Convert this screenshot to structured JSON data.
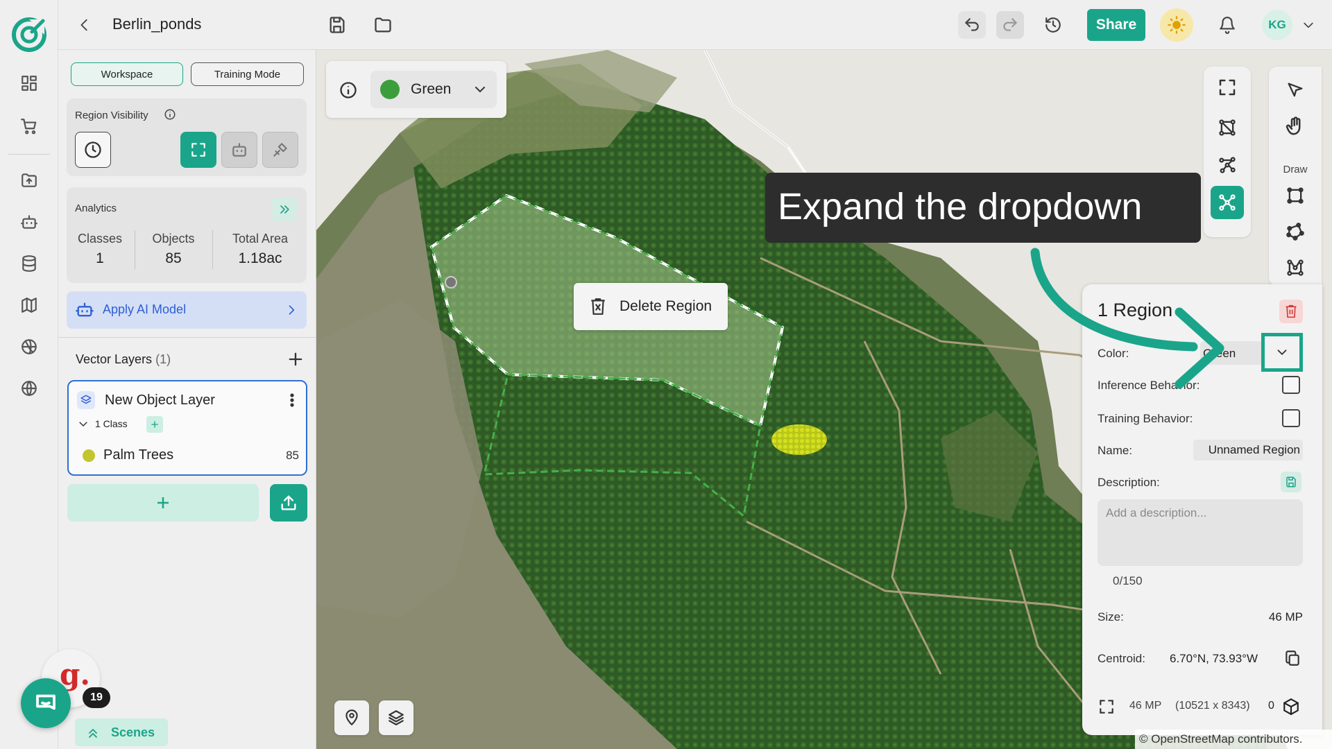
{
  "header": {
    "project_title": "Berlin_ponds",
    "share_label": "Share",
    "avatar_initials": "KG"
  },
  "rail": {
    "icons": [
      "logo-icon",
      "dashboard-icon",
      "cart-icon",
      "folder-upload-icon",
      "robot-icon",
      "database-icon",
      "map-icon",
      "globe-grid-icon",
      "globe-icon"
    ]
  },
  "panel": {
    "workspace_label": "Workspace",
    "training_label": "Training Mode",
    "region_visibility_label": "Region Visibility",
    "analytics": {
      "label": "Analytics",
      "stats": [
        {
          "label": "Classes",
          "value": "1"
        },
        {
          "label": "Objects",
          "value": "85"
        },
        {
          "label": "Total Area",
          "value": "1.18ac"
        }
      ]
    },
    "apply_ai_label": "Apply AI Model",
    "vector_layers": {
      "title": "Vector Layers",
      "count": "(1)",
      "layer": {
        "name": "New Object Layer",
        "class_count": "1 Class",
        "classes": [
          {
            "name": "Palm Trees",
            "objects": "85",
            "color": "#c1c52e"
          }
        ]
      }
    },
    "badge_letter": "g.",
    "chat_count": "19",
    "scenes_label": "Scenes"
  },
  "map": {
    "class_picker": {
      "label": "Green",
      "color": "#3c9d3c"
    },
    "delete_region_label": "Delete Region",
    "draw_label": "Draw",
    "tooltip": "Expand the dropdown",
    "attribution": "© OpenStreetMap contributors."
  },
  "region_panel": {
    "title": "1 Region",
    "color_label": "Color:",
    "color_value": "Green",
    "inference_label": "Inference Behavior:",
    "training_label": "Training Behavior:",
    "name_label": "Name:",
    "name_value": "Unnamed Region",
    "description_label": "Description:",
    "description_placeholder": "Add a description...",
    "description_count": "0/150",
    "size_label": "Size:",
    "size_value": "46 MP",
    "centroid_label": "Centroid:",
    "centroid_value": "6.70°N, 73.93°W",
    "footer_mp": "46 MP",
    "footer_dims": "(10521 x 8343)",
    "footer_count": "0"
  },
  "colors": {
    "accent": "#1aa58a",
    "ai_blue": "#2f5fd3",
    "danger": "#d23b3b"
  }
}
